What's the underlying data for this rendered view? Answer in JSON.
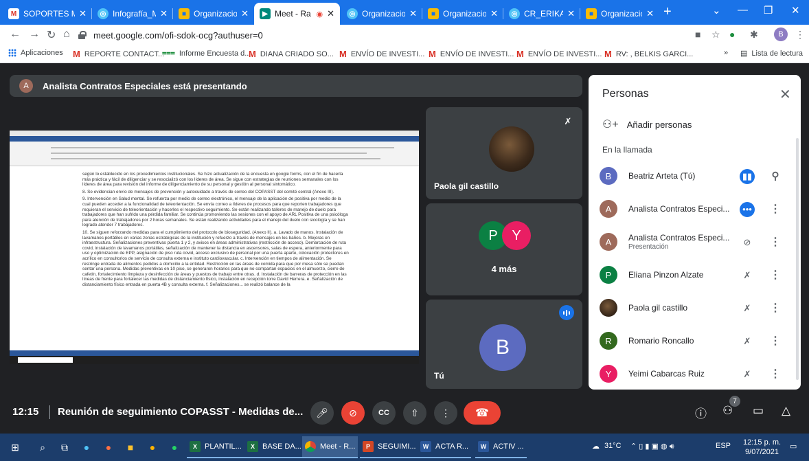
{
  "browser": {
    "tabs": [
      {
        "label": "SOPORTES M",
        "icon": "gmail-icon"
      },
      {
        "label": "Infografía_Mo",
        "icon": "web-icon"
      },
      {
        "label": "Organizacion",
        "icon": "org-icon"
      },
      {
        "label": "Meet - Ra",
        "icon": "meet-icon",
        "active": true
      },
      {
        "label": "Organizacion",
        "icon": "web-icon"
      },
      {
        "label": "Organizacion",
        "icon": "org-icon"
      },
      {
        "label": "CR_ERIKAPRE",
        "icon": "web-icon"
      },
      {
        "label": "Organizacion",
        "icon": "org-icon"
      }
    ],
    "new_tab": "+",
    "url": "meet.google.com/ofi-sdok-ocg?authuser=0",
    "profile_initial": "B",
    "bookmarks": [
      {
        "label": "Aplicaciones",
        "icon": "apps-grid-icon"
      },
      {
        "label": "REPORTE CONTACT...",
        "icon": "gmail-icon"
      },
      {
        "label": "Informe Encuesta d...",
        "icon": "forms-icon"
      },
      {
        "label": "DIANA CRIADO SO...",
        "icon": "gmail-icon"
      },
      {
        "label": "ENVÍO DE INVESTI...",
        "icon": "gmail-icon"
      },
      {
        "label": "ENVÍO DE INVESTI...",
        "icon": "gmail-icon"
      },
      {
        "label": "ENVÍO DE INVESTI...",
        "icon": "gmail-icon"
      },
      {
        "label": "RV: , BELKIS GARCI...",
        "icon": "gmail-icon"
      }
    ],
    "more_bookmarks": "»",
    "reading_list": "Lista de lectura"
  },
  "meet": {
    "presenter_banner": "Analista Contratos Especiales está presentando",
    "presenter_initial": "A",
    "shared_doc": {
      "paragraphs": [
        "según lo establecido en los procedimientos institucionales. Se hizo actualización de la encuesta en google forms, con el fin de hacerla más práctica y fácil de diligenciar y se resocializó con los líderes de área. Se sigue con estrategias de reuniones semanales con los líderes de área para revisión del informe de diligenciamiento de su personal y gestión al personal sintomático.",
        "8. Se evidencian envío de mensajes de prevención y autocuidado a través de correo del COPASST del comité central (Anexo III).",
        "9. Intervención en Salud mental. Se refuerza por medio de correo electrónico, el mensaje de la aplicación de positiva por medio de la cual pueden acceder a la funcionalidad de teleorientación. Se envía correo a líderes de procesos para que reporten trabajadores que requieran el servicio de teleorientación y hacerles el respectivo seguimiento. Se están realizando talleres de manejo de duelo para trabajadores que han sufrido una pérdida familiar. Se continúa promoviendo las sesiones con el apoyo de ARL Positiva de una psicóloga para atención de trabajadores por 2 horas semanales. Se están realizando actividades para el manejo del duelo con sicología y se han logrado atender 7 trabajadores.",
        "10. Se siguen reforzando medidas para el cumplimiento del protocolo de bioseguridad. (Anexo II). a. Lavado de manos. Instalación de lavamanos portátiles en varias zonas estratégicas de la institución y refuerzo a través de mensajes en los baños. b. Mejoras en infraestructura. Señalizaciones preventivas puerta 1 y 2, y avisos en áreas administrativas (restricción de acceso). Demarcación de ruta covid, instalación de lavamanos portátiles, señalización de mantener la distancia en ascensores, salas de espera, anteriormente para uso y optimización de EPP, asignación de piso ruta covid, acceso exclusivo de personal por una puerta aparte, colocación protectores en acrílico en consultorios de servicio de consulta externa e instituto cardiovascular. c. Intervención en tiempos de alimentación. Se restringe entrada de alimentos pedidos a domicilio a la entidad. Restricción en las áreas de comida para que por mesa sólo se puedan sentar una persona. Medidas preventivas en 10 piso, se generaron horarios para que no compartan espacios en el almuerzo, cierre de cafetín, fortalecimiento limpieza y desinfección de áreas y puestos de trabajo entre otras. d. Instalación de barreras de protección en las líneas de frente para fortalecer las medidas de distanciamiento físico, instalación en recepción torre David Herrera. e. Señalización de distanciamiento físico entrada en puerta 4B y consulta externa. f. Señalizaciones... se realizó balance de la"
      ]
    },
    "tiles": {
      "paola": {
        "name": "Paola gil castillo"
      },
      "group": {
        "initials": [
          "P",
          "Y"
        ],
        "label": "4 más"
      },
      "self": {
        "initial": "B",
        "name": "Tú"
      }
    },
    "controls": {
      "time": "12:15",
      "meeting_title": "Reunión de seguimiento COPASST - Medidas de...",
      "participant_count": "7"
    },
    "people_panel": {
      "title": "Personas",
      "add_people": "Añadir personas",
      "in_call_label": "En la llamada",
      "participants": [
        {
          "initial": "B",
          "name": "Beatriz Arteta (Tú)",
          "color": "#5c6bc0",
          "status": "speaking",
          "action": "pin"
        },
        {
          "initial": "A",
          "name": "Analista Contratos Especi...",
          "color": "#9e6a5b",
          "status": "more-dots",
          "action": "more"
        },
        {
          "initial": "A",
          "name": "Analista Contratos Especi...",
          "subtitle": "Presentación",
          "color": "#9e6a5b",
          "status": "presentation-muted",
          "action": "more"
        },
        {
          "initial": "P",
          "name": "Eliana Pinzon Alzate",
          "color": "#0b8043",
          "status": "muted",
          "action": "more"
        },
        {
          "initial": "",
          "name": "Paola gil castillo",
          "color": "#5a4230",
          "status": "muted",
          "action": "more"
        },
        {
          "initial": "R",
          "name": "Romario Roncallo",
          "color": "#33691e",
          "status": "muted",
          "action": "more"
        },
        {
          "initial": "Y",
          "name": "Yeimi Cabarcas Ruiz",
          "color": "#e91e63",
          "status": "muted",
          "action": "more"
        }
      ]
    }
  },
  "taskbar": {
    "apps": [
      {
        "label": "PLANTIL...",
        "icon": "excel-icon"
      },
      {
        "label": "BASE DA...",
        "icon": "excel-icon"
      },
      {
        "label": "Meet - R...",
        "icon": "chrome-icon",
        "active": true
      },
      {
        "label": "SEGUIMI...",
        "icon": "powerpoint-icon"
      },
      {
        "label": "ACTA R...",
        "icon": "word-icon"
      },
      {
        "label": "ACTIV ...",
        "icon": "word-icon"
      }
    ],
    "temperature": "31°C",
    "language": "ESP",
    "clock_time": "12:15 p. m.",
    "clock_date": "9/07/2021"
  }
}
